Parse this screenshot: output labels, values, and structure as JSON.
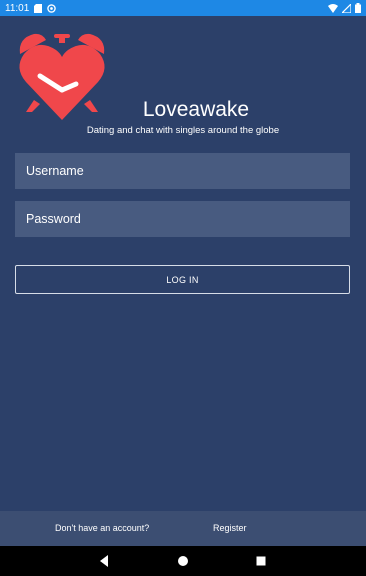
{
  "status_bar": {
    "time": "11:01",
    "left_icons": [
      "sd-card-icon",
      "sync-icon"
    ],
    "right_icons": [
      "wifi-icon",
      "signal-icon",
      "battery-icon"
    ]
  },
  "app": {
    "title": "Loveawake",
    "tagline": "Dating and chat with singles around the globe"
  },
  "login_form": {
    "username_placeholder": "Username",
    "username_value": "",
    "password_placeholder": "Password",
    "password_value": "",
    "login_label": "LOG IN"
  },
  "footer": {
    "prompt": "Don't have an account?",
    "register_label": "Register"
  },
  "nav_bar": {
    "buttons": [
      "back-icon",
      "home-icon",
      "recents-icon"
    ]
  },
  "colors": {
    "background": "#2c4069",
    "status_bar": "#1e88e5",
    "field_background": "#485b80",
    "footer_background": "#3c4e72",
    "logo_heart": "#f0474b"
  }
}
